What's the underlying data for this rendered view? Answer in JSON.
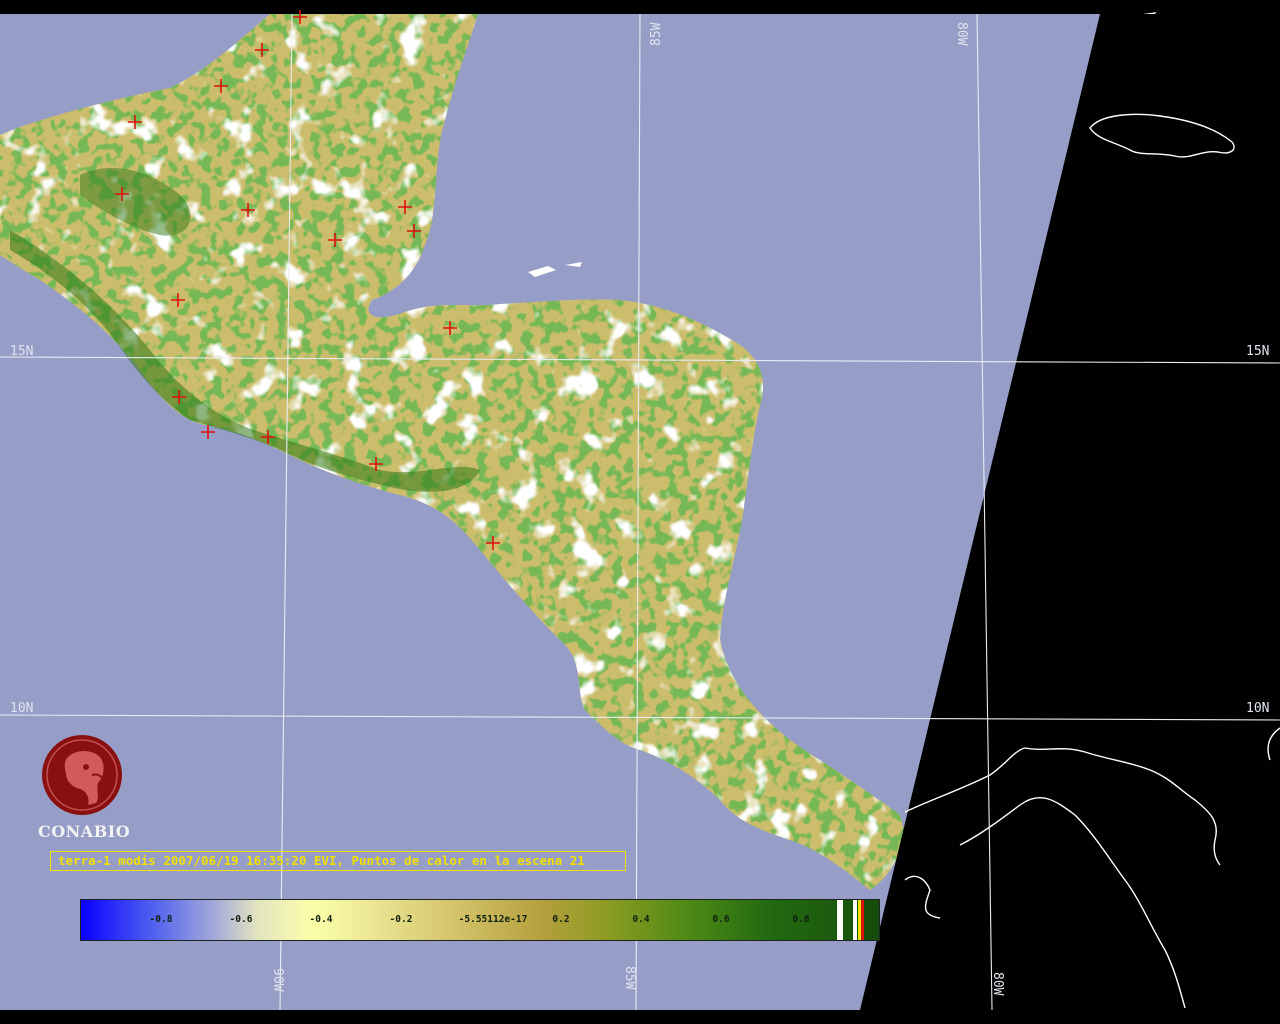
{
  "map": {
    "grid_labels": {
      "lon_top": [
        "85W",
        "80W"
      ],
      "lon_bottom": [
        "90W",
        "85W",
        "80W"
      ],
      "lat_left": [
        "15N",
        "10N"
      ],
      "lat_right": [
        "15N",
        "10N"
      ]
    },
    "colors": {
      "ocean": "#969ec8",
      "night": "#000000",
      "vegetation_dense": "#2f7a18",
      "vegetation_sparse": "#c9bc6a",
      "cloud": "#ffffff",
      "hotspot": "#e01010",
      "grid": "#e8ecf2"
    },
    "hotspot_icon": "red-plus-marker"
  },
  "logo": {
    "icon": "conabio-emblem-icon",
    "name": "CONABIO",
    "color": "#8a1010"
  },
  "caption": "terra-1 modis 2007/06/19 16:35:20 EVI, Puntos de calor en la escena 21",
  "colorbar": {
    "labels": [
      "-0.8",
      "-0.6",
      "-0.4",
      "-0.2",
      "-5.55112e-17",
      "0.2",
      "0.4",
      "0.6",
      "0.8"
    ]
  }
}
